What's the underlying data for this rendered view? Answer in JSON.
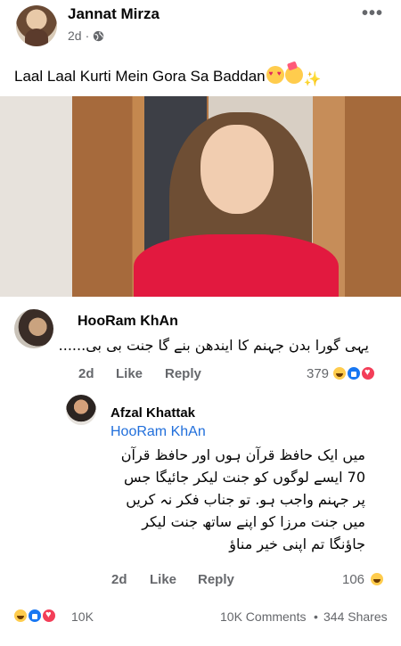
{
  "post": {
    "author": "Jannat Mirza",
    "time": "2d",
    "caption": "Laal Laal Kurti Mein Gora Sa Baddan",
    "more_icon": "more-dots-icon",
    "privacy_icon": "globe-icon"
  },
  "comments": [
    {
      "author": "HooRam KhAn",
      "text": "یہی گورا بدن جہنم کا ایندھن بنے گا جنت بی بی......",
      "time": "2d",
      "like_label": "Like",
      "reply_label": "Reply",
      "reaction_count": "379",
      "reactions": [
        "haha",
        "like",
        "love"
      ]
    },
    {
      "author": "Afzal Khattak",
      "mention": "HooRam KhAn",
      "text": "میں ایک حافظ قرآن ہوں اور حافظ قرآن 70 ایسے لوگوں کو جنت لیکر جائیگا جس پر جہنم واجب ہو. تو جناب فکر نہ کریں میں جنت مرزا کو اپنے ساتھ جنت لیکر جاؤنگا تم اپنی خیر مناؤ",
      "time": "2d",
      "like_label": "Like",
      "reply_label": "Reply",
      "reaction_count": "106",
      "reactions": [
        "haha"
      ]
    }
  ],
  "footer": {
    "reaction_count": "10K",
    "comments": "10K Comments",
    "separator": "•",
    "shares": "344 Shares",
    "reactions": [
      "haha",
      "like",
      "love"
    ]
  },
  "colors": {
    "link": "#216fdb",
    "meta": "#65676b",
    "like_blue": "#1877f2",
    "love_red": "#f33e58",
    "haha_yellow": "#ffcc4d"
  }
}
